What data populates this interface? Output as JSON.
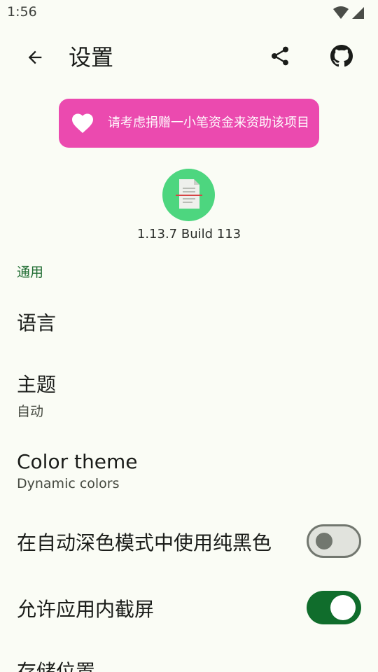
{
  "status_bar": {
    "time": "1:56"
  },
  "app_bar": {
    "title": "设置"
  },
  "donate": {
    "text": "请考虑捐赠一小笔资金来资助该项目",
    "color": "#eb4aaf"
  },
  "about": {
    "version": "1.13.7 Build 113",
    "logo_color": "#4dd67f"
  },
  "sections": {
    "general": {
      "header": "通用",
      "language": {
        "title": "语言"
      },
      "theme": {
        "title": "主题",
        "summary": "自动"
      },
      "color_theme": {
        "title": "Color theme",
        "summary": "Dynamic colors"
      },
      "pure_black": {
        "title": "在自动深色模式中使用纯黑色",
        "enabled": false
      },
      "allow_screenshot": {
        "title": "允许应用内截屏",
        "enabled": true
      },
      "storage": {
        "title": "存储位置"
      }
    }
  },
  "colors": {
    "accent": "#106d2c",
    "section_header": "#1d6b30",
    "background": "#fafcf5"
  }
}
